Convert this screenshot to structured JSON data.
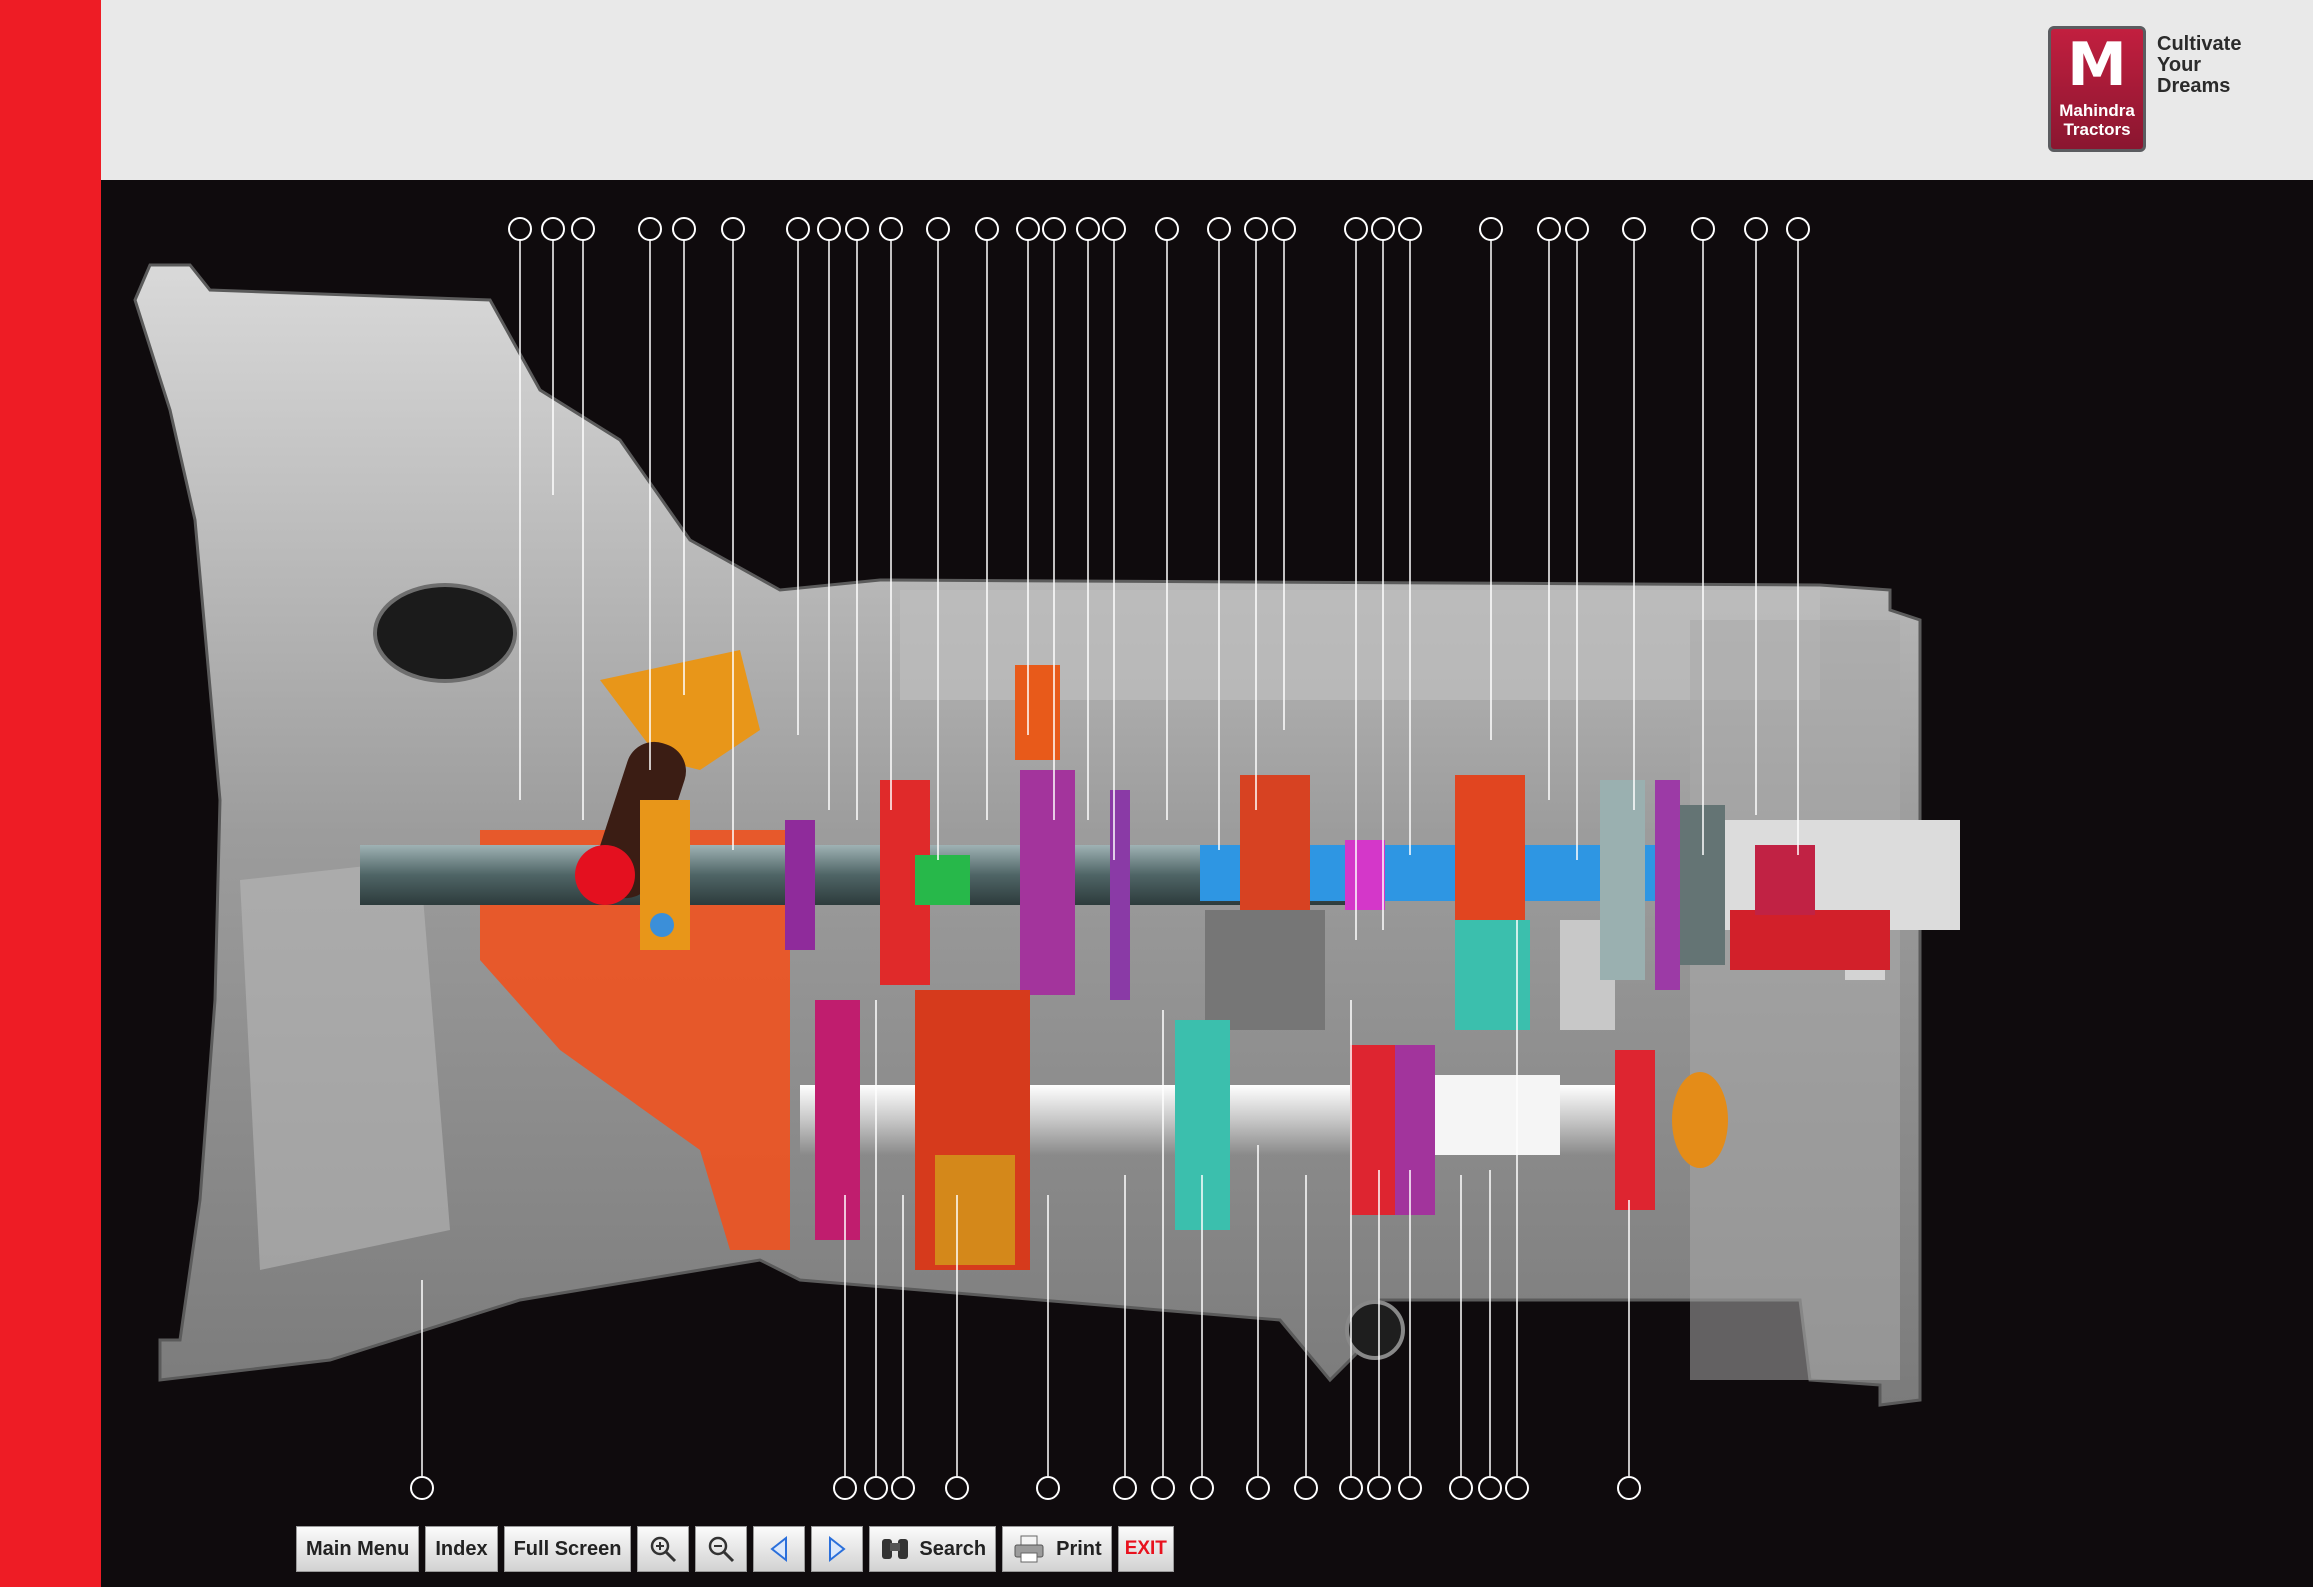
{
  "header": {
    "logo_brand_line1": "Mahindra",
    "logo_brand_line2": "Tractors",
    "tagline_line1": "Cultivate",
    "tagline_line2": "Your",
    "tagline_line3": "Dreams"
  },
  "colors": {
    "sidebar": "#ee1c25",
    "header_bg": "#e9e9e9",
    "stage_bg": "#0f0b0d",
    "exit_text": "#e8121e"
  },
  "diagram": {
    "subject": "gearbox cutaway with callout markers",
    "top_callout_count": 39,
    "bottom_callout_count": 19
  },
  "toolbar": {
    "main_menu": "Main Menu",
    "index": "Index",
    "full_screen": "Full Screen",
    "zoom_in_icon": "zoom-in-icon",
    "zoom_out_icon": "zoom-out-icon",
    "previous_icon": "previous-icon",
    "next_icon": "next-icon",
    "search": "Search",
    "print": "Print",
    "exit": "EXIT"
  }
}
